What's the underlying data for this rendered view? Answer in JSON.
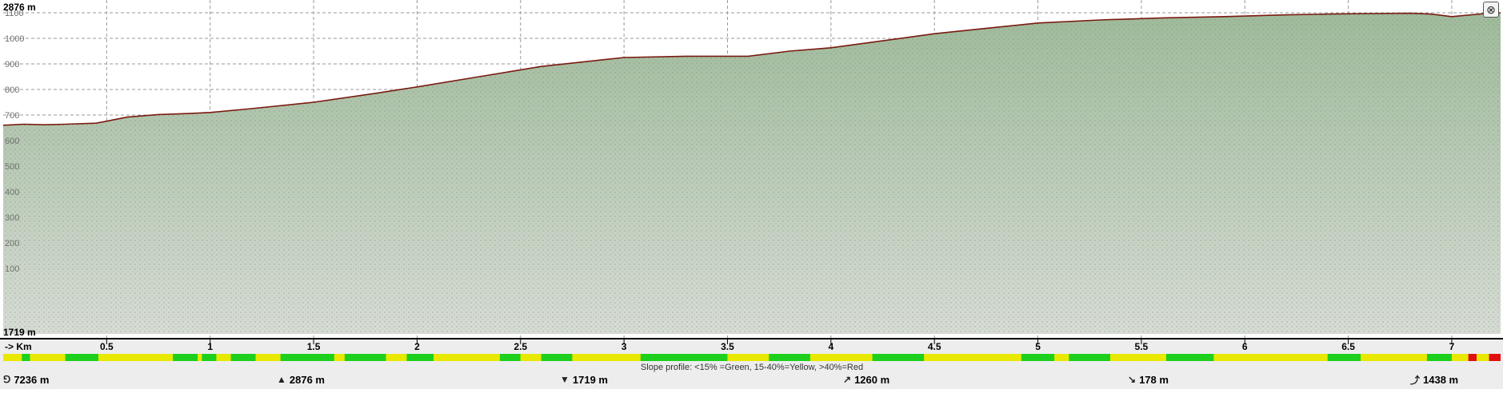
{
  "chart_data": {
    "type": "area",
    "ylim": [
      600,
      1100
    ],
    "xlim": [
      0,
      7.236
    ],
    "y_top_label": "2876 m",
    "y_bottom_label": "1719 m",
    "x_unit_label": "-> Km",
    "y_ticks": [
      "1100",
      "1000",
      "900",
      "800",
      "700",
      "600",
      "500",
      "400",
      "300",
      "200",
      "100"
    ],
    "x_ticks": [
      "0.5",
      "1",
      "1.5",
      "2",
      "2.5",
      "3",
      "3.5",
      "4",
      "4.5",
      "5",
      "5.5",
      "6",
      "6.5",
      "7"
    ],
    "x_tick_values": [
      0.5,
      1,
      1.5,
      2,
      2.5,
      3,
      3.5,
      4,
      4.5,
      5,
      5.5,
      6,
      6.5,
      7
    ],
    "x": [
      0,
      0.1,
      0.2,
      0.3,
      0.45,
      0.5,
      0.6,
      0.75,
      0.9,
      1.0,
      1.2,
      1.5,
      1.8,
      2.0,
      2.3,
      2.6,
      3.0,
      3.3,
      3.6,
      3.8,
      4.0,
      4.2,
      4.5,
      4.7,
      5.0,
      5.3,
      5.6,
      5.9,
      6.2,
      6.4,
      6.6,
      6.8,
      6.9,
      7.0,
      7.2,
      7.236
    ],
    "y": [
      660,
      664,
      662,
      664,
      668,
      676,
      692,
      702,
      706,
      710,
      725,
      750,
      785,
      810,
      850,
      890,
      925,
      930,
      930,
      950,
      963,
      985,
      1018,
      1035,
      1060,
      1072,
      1080,
      1085,
      1092,
      1095,
      1097,
      1098,
      1095,
      1085,
      1100,
      1100
    ],
    "slope_legend": "Slope profile: <15% =Green, 15-40%=Yellow, >40%=Red",
    "slope_colors": {
      "green": "#1ed01e",
      "yellow": "#e8e800",
      "red": "#e01010"
    },
    "slope_segments": [
      [
        "y",
        0.0,
        0.09
      ],
      [
        "g",
        0.09,
        0.13
      ],
      [
        "y",
        0.13,
        0.3
      ],
      [
        "g",
        0.3,
        0.46
      ],
      [
        "y",
        0.46,
        0.82
      ],
      [
        "g",
        0.82,
        0.94
      ],
      [
        "y",
        0.94,
        0.96
      ],
      [
        "g",
        0.96,
        1.03
      ],
      [
        "y",
        1.03,
        1.1
      ],
      [
        "g",
        1.1,
        1.22
      ],
      [
        "y",
        1.22,
        1.34
      ],
      [
        "g",
        1.34,
        1.6
      ],
      [
        "y",
        1.6,
        1.65
      ],
      [
        "g",
        1.65,
        1.85
      ],
      [
        "y",
        1.85,
        1.95
      ],
      [
        "g",
        1.95,
        2.08
      ],
      [
        "y",
        2.08,
        2.4
      ],
      [
        "g",
        2.4,
        2.5
      ],
      [
        "y",
        2.5,
        2.6
      ],
      [
        "g",
        2.6,
        2.75
      ],
      [
        "y",
        2.75,
        3.08
      ],
      [
        "g",
        3.08,
        3.5
      ],
      [
        "y",
        3.5,
        3.7
      ],
      [
        "g",
        3.7,
        3.9
      ],
      [
        "y",
        3.9,
        4.2
      ],
      [
        "g",
        4.2,
        4.45
      ],
      [
        "y",
        4.45,
        4.92
      ],
      [
        "g",
        4.92,
        5.08
      ],
      [
        "y",
        5.08,
        5.15
      ],
      [
        "g",
        5.15,
        5.35
      ],
      [
        "y",
        5.35,
        5.62
      ],
      [
        "g",
        5.62,
        5.85
      ],
      [
        "y",
        5.85,
        6.4
      ],
      [
        "g",
        6.4,
        6.56
      ],
      [
        "y",
        6.56,
        6.88
      ],
      [
        "g",
        6.88,
        7.0
      ],
      [
        "y",
        7.0,
        7.08
      ],
      [
        "r",
        7.08,
        7.12
      ],
      [
        "y",
        7.12,
        7.18
      ],
      [
        "r",
        7.18,
        7.236
      ]
    ]
  },
  "stats": {
    "distance": "7236 m",
    "max_elevation": "2876 m",
    "min_elevation": "1719 m",
    "total_ascent": "1260 m",
    "total_descent": "178 m",
    "elevation_gain": "1438 m"
  },
  "icons": {
    "distance": "route-icon",
    "max": "peak-high-icon",
    "min": "peak-low-icon",
    "ascent": "ascent-icon",
    "descent": "descent-icon",
    "gain": "gain-icon",
    "close": "close-icon"
  },
  "colors": {
    "profile_line": "#7a1a10",
    "fill": "#a9c0a6",
    "grid": "#9a9a9a"
  }
}
